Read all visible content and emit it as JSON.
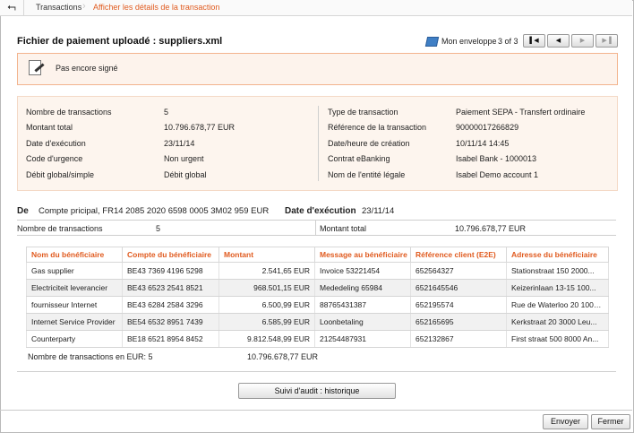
{
  "breadcrumb": {
    "items": [
      "Transactions",
      "Afficher les détails de la transaction"
    ]
  },
  "page": {
    "title": "Fichier de paiement uploadé : suppliers.xml"
  },
  "envelope": {
    "label": "Mon enveloppe",
    "count": "3 of 3",
    "nav_icons": [
      "first-page-icon",
      "previous-icon",
      "next-icon",
      "last-page-icon"
    ]
  },
  "notice": {
    "text": "Pas encore signé"
  },
  "details": {
    "left": [
      {
        "label": "Nombre de transactions",
        "value": "5"
      },
      {
        "label": "Montant total",
        "value": "10.796.678,77 EUR"
      },
      {
        "label": "Date d'exécution",
        "value": "23/11/14"
      },
      {
        "label": "Code d'urgence",
        "value": "Non urgent"
      },
      {
        "label": "Débit global/simple",
        "value": "Débit global"
      }
    ],
    "right": [
      {
        "label": "Type de transaction",
        "value": "Paiement SEPA - Transfert ordinaire"
      },
      {
        "label": "Référence de la transaction",
        "value": "90000017266829"
      },
      {
        "label": "Date/heure de création",
        "value": "10/11/14 14:45"
      },
      {
        "label": "Contrat eBanking",
        "value": "Isabel Bank - 1000013"
      },
      {
        "label": "Nom de l'entité légale",
        "value": "Isabel Demo account 1"
      }
    ]
  },
  "debit": {
    "de_label": "De",
    "account": "Compte pricipal, FR14 2085 2020 6598 0005 3M02 959 EUR",
    "exec_label": "Date d'exécution",
    "exec_date": "23/11/14",
    "count_label": "Nombre de transactions",
    "count_value": "5",
    "total_label": "Montant total",
    "total_value": "10.796.678,77 EUR"
  },
  "beneficiaries": {
    "headers": [
      "Nom du bénéficiaire",
      "Compte du bénéficiaire",
      "Montant",
      "Message au bénéficiaire",
      "Référence client (E2E)",
      "Adresse du bénéficiaire"
    ],
    "rows": [
      [
        "Gas supplier",
        "BE43 7369 4196 5298",
        "2.541,65 EUR",
        "Invoice 53221454",
        "652564327",
        "Stationstraat 150 2000..."
      ],
      [
        "Electriciteit leverancier",
        "BE43 6523 2541 8521",
        "968.501,15 EUR",
        "Mededeling 65984",
        "6521645546",
        "Keizerinlaan 13-15 100..."
      ],
      [
        "fournisseur Internet",
        "BE43 6284 2584 3296",
        "6.500,99 EUR",
        "88765431387",
        "652195574",
        "Rue de Waterloo 20 1000..."
      ],
      [
        "Internet Service Provider",
        "BE54 6532 8951 7439",
        "6.585,99 EUR",
        "Loonbetaling",
        "652165695",
        "Kerkstraat 20 3000 Leu..."
      ],
      [
        "Counterparty",
        "BE18 6521 8954 8452",
        "9.812.548,99 EUR",
        "21254487931",
        "652132867",
        "First straat 500 8000 An..."
      ]
    ],
    "summary_label": "Nombre de transactions en EUR: 5",
    "summary_total": "10.796.678,77 EUR"
  },
  "actions": {
    "audit": "Suivi d'audit : historique",
    "send": "Envoyer",
    "close": "Fermer"
  },
  "colors": {
    "accent": "#e05a1e",
    "notice_bg": "#fdf3ec",
    "notice_border": "#f3b48e",
    "details_bg": "#fdf5ee"
  }
}
